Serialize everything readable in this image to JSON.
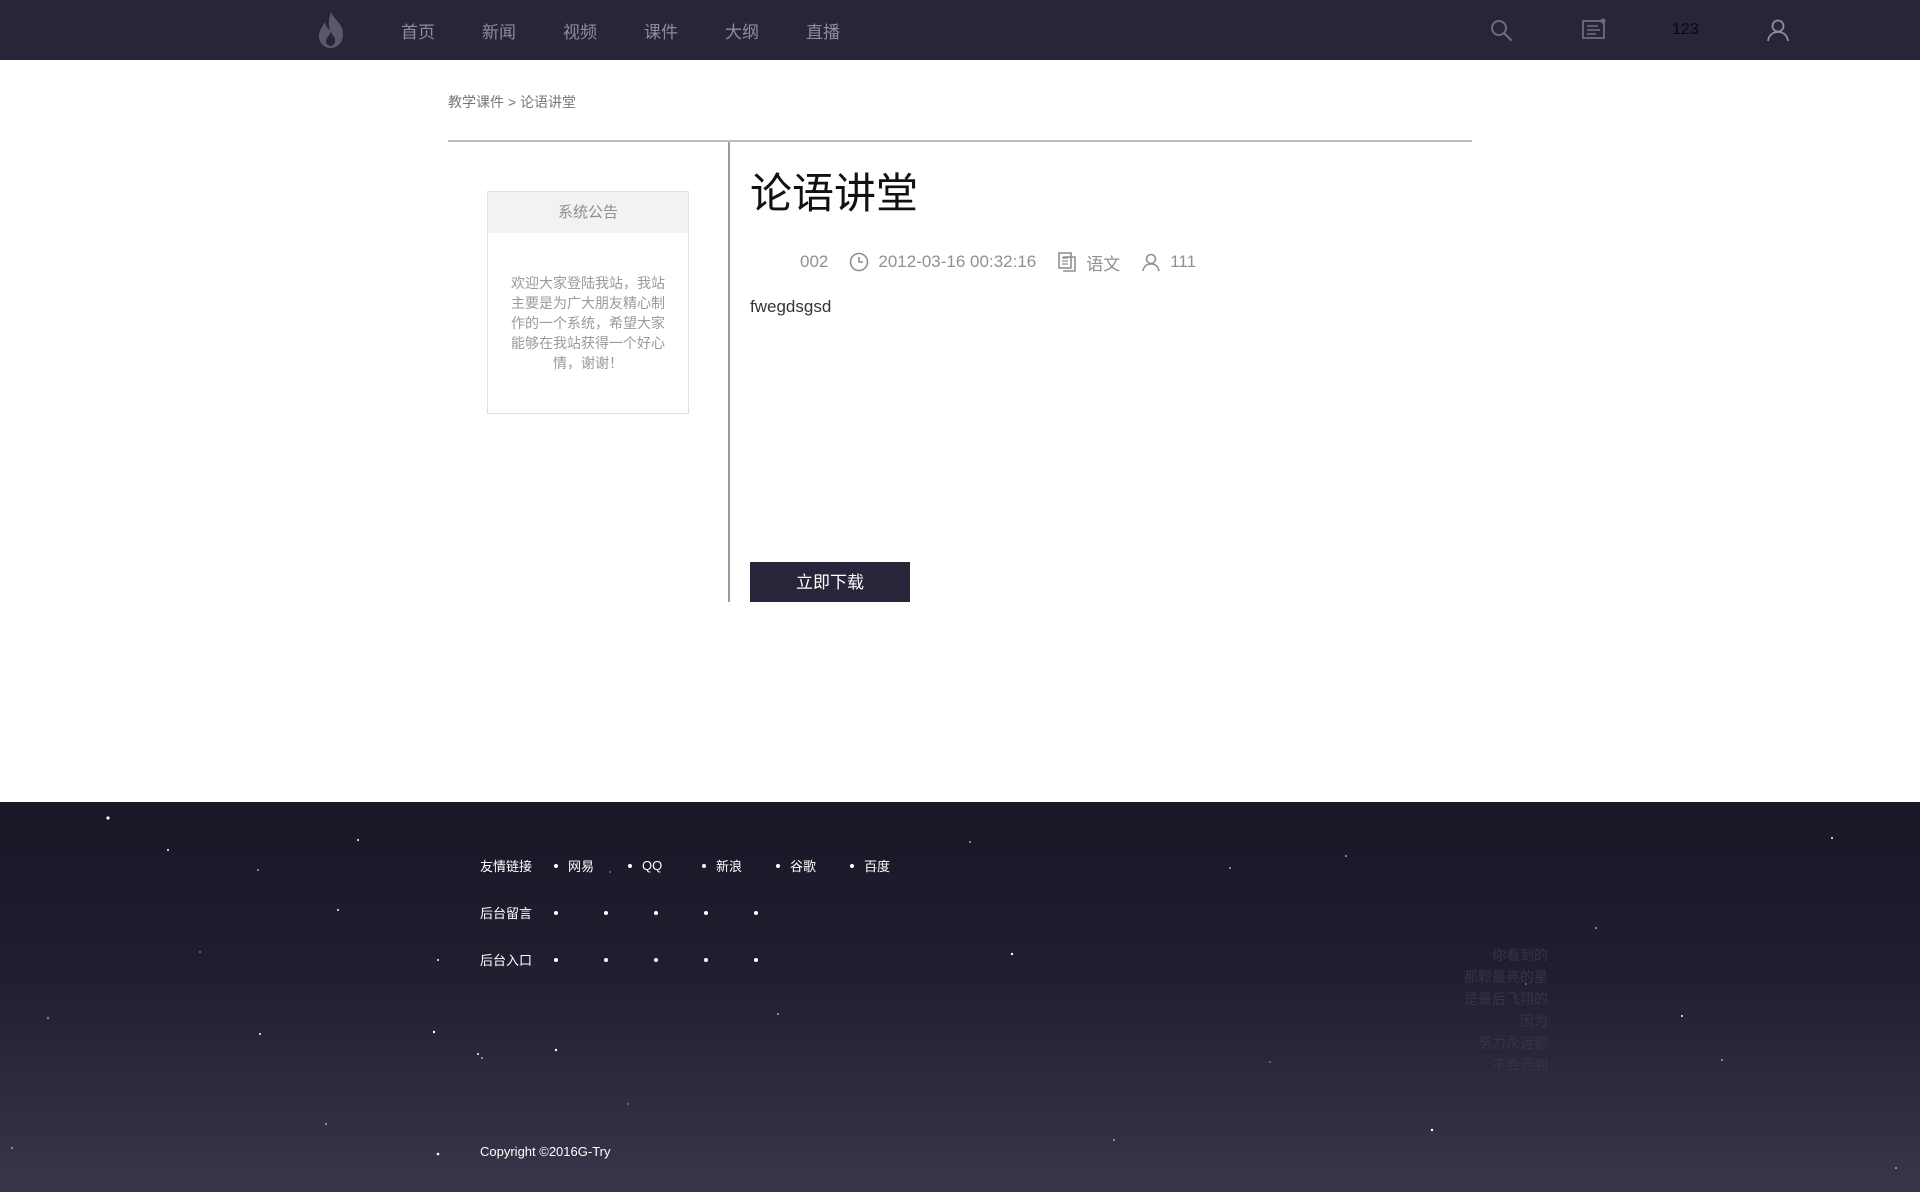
{
  "nav": {
    "items": [
      "首页",
      "新闻",
      "视频",
      "课件",
      "大纲",
      "直播"
    ],
    "user_number": "123"
  },
  "breadcrumb": "教学课件 > 论语讲堂",
  "notice": {
    "title": "系统公告",
    "body": "欢迎大家登陆我站，我站主要是为广大朋友精心制作的一个系统，希望大家能够在我站获得一个好心情，谢谢！"
  },
  "article": {
    "title": "论语讲堂",
    "code": "002",
    "datetime": "2012-03-16 00:32:16",
    "subject": "语文",
    "views": "111",
    "content": "fwegdsgsd",
    "download_label": "立即下载"
  },
  "footer": {
    "rows": [
      {
        "label": "友情链接",
        "links": [
          "网易",
          "QQ",
          "新浪",
          "谷歌",
          "百度"
        ]
      },
      {
        "label": "后台留言",
        "links": [
          "",
          "",
          "",
          "",
          ""
        ]
      },
      {
        "label": "后台入口",
        "links": [
          "",
          "",
          "",
          "",
          ""
        ]
      }
    ],
    "poem": [
      "你看到的",
      "那颗最亮的星",
      "是最后飞翔的",
      "因为",
      "努力永远都",
      "不会迟到"
    ],
    "copyright": "Copyright ©2016G-Try"
  }
}
